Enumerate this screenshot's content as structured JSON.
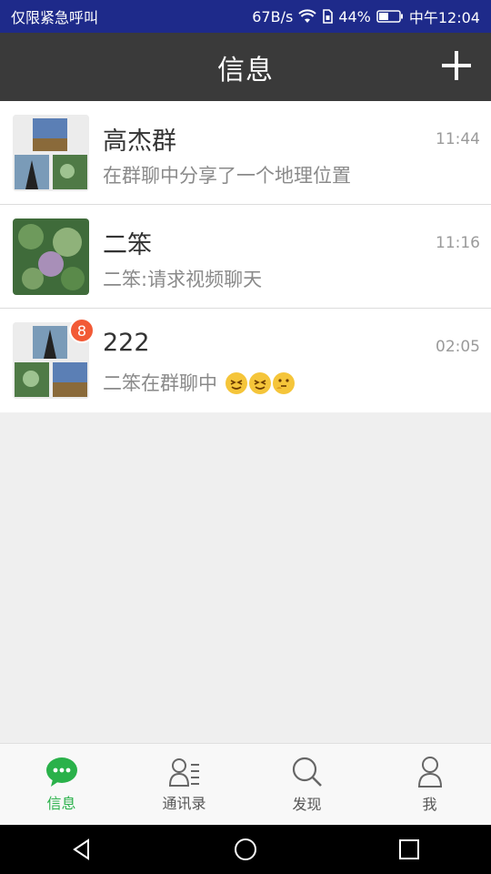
{
  "status_bar": {
    "left_text": "仅限紧急呼叫",
    "speed": "67B/s",
    "battery": "44%",
    "time": "中午12:04",
    "icons": [
      "wifi-icon",
      "sim-icon",
      "battery-icon"
    ]
  },
  "header": {
    "title": "信息",
    "add_icon": "plus-icon"
  },
  "conversations": [
    {
      "name": "高杰群",
      "time": "11:44",
      "preview": "在群聊中分享了一个地理位置",
      "badge": null,
      "avatar": "group-collage"
    },
    {
      "name": "二笨",
      "time": "11:16",
      "preview": "二笨:请求视频聊天",
      "badge": null,
      "avatar": "plant-photo"
    },
    {
      "name": "222",
      "time": "02:05",
      "preview": "二笨在群聊中",
      "badge": "8",
      "avatar": "group-collage",
      "preview_emojis": [
        "grinning-squint-emoji",
        "grinning-squint-emoji",
        "thinking-emoji"
      ]
    }
  ],
  "bottom_nav": {
    "items": [
      {
        "label": "信息",
        "icon": "chat-bubble-icon",
        "active": true
      },
      {
        "label": "通讯录",
        "icon": "contacts-icon",
        "active": false
      },
      {
        "label": "发现",
        "icon": "search-icon",
        "active": false
      },
      {
        "label": "我",
        "icon": "person-icon",
        "active": false
      }
    ]
  },
  "system_nav": [
    "back-icon",
    "home-icon",
    "recents-icon"
  ],
  "colors": {
    "status_bar": "#1e2a8a",
    "header": "#3a3a3a",
    "accent": "#2ab14a",
    "badge": "#f25a36"
  }
}
